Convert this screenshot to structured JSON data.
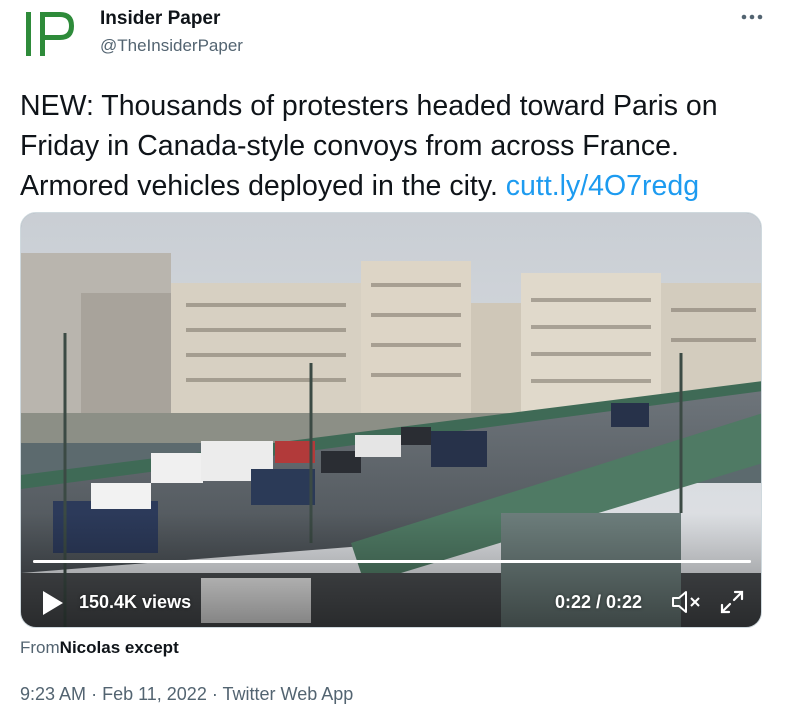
{
  "author": {
    "name": "Insider Paper",
    "handle": "@TheInsiderPaper",
    "avatar_text": "IP"
  },
  "tweet": {
    "text": "NEW: Thousands of protesters headed toward Paris on Friday in Canada-style convoys from across France. Armored vehicles deployed in the city. ",
    "link": "cutt.ly/4O7redg"
  },
  "video": {
    "views": "150.4K views",
    "time": "0:22 / 0:22",
    "progress": 1.0
  },
  "attribution": {
    "prefix": "From",
    "name": "Nicolas except"
  },
  "meta": {
    "time": "9:23 AM",
    "date": "Feb 11, 2022",
    "source": "Twitter Web App",
    "separator": "·"
  },
  "colors": {
    "link": "#1d9bf0",
    "avatar_green": "#2e8b3a",
    "secondary_text": "#536471"
  },
  "icons": {
    "more": "more-icon",
    "play": "play-icon",
    "mute": "mute-icon",
    "expand": "expand-icon"
  }
}
